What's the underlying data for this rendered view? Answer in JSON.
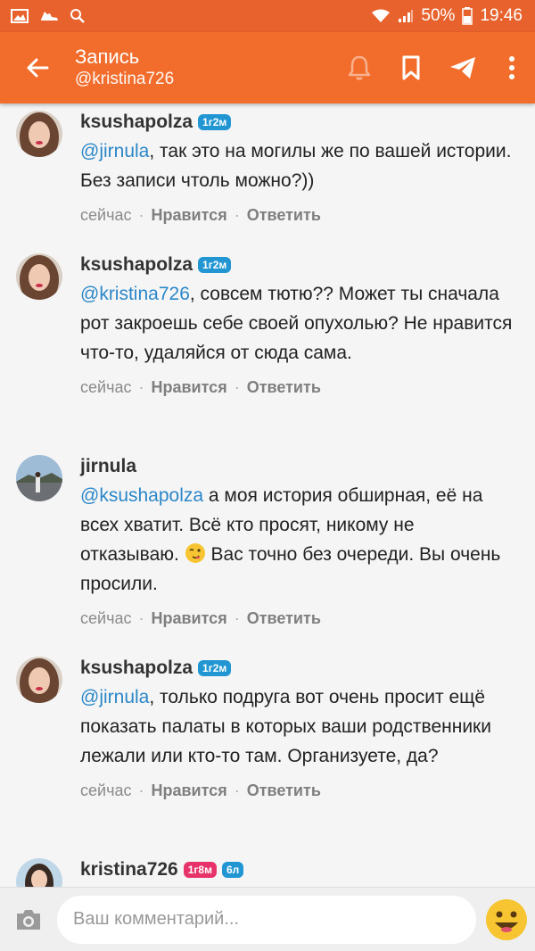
{
  "status_bar": {
    "battery": "50%",
    "time": "19:46"
  },
  "header": {
    "title": "Запись",
    "subtitle": "@kristina726"
  },
  "comments": [
    {
      "author": "ksushapolza",
      "badges": [
        "1г2м"
      ],
      "mention": "@jirnula",
      "text": ", так это на могилы же по вашей истории. Без записи чтоль можно?))",
      "time": "сейчас",
      "like": "Нравится",
      "reply": "Ответить"
    },
    {
      "author": "ksushapolza",
      "badges": [
        "1г2м"
      ],
      "mention": "@kristina726",
      "text": ", совсем тютю?? Может ты сначала рот закроешь себе своей опухолью? Не нравится что-то, удаляйся от сюда сама.",
      "time": "сейчас",
      "like": "Нравится",
      "reply": "Ответить"
    },
    {
      "author": "jirnula",
      "badges": [],
      "mention": "@ksushapolza",
      "text_before_emoji": " а моя история обширная, её на всех хватит. Всё кто просят, никому не отказываю.",
      "text_after_emoji": " Вас точно без очереди. Вы очень просили.",
      "time": "сейчас",
      "like": "Нравится",
      "reply": "Ответить"
    },
    {
      "author": "ksushapolza",
      "badges": [
        "1г2м"
      ],
      "mention": "@jirnula",
      "text": ", только подруга вот очень просит ещё показать палаты в которых ваши родственники лежали или кто-то там. Организуете, да?",
      "time": "сейчас",
      "like": "Нравится",
      "reply": "Ответить"
    },
    {
      "author": "kristina726",
      "badges": [
        "1г8м",
        "6л"
      ]
    }
  ],
  "comment_input": {
    "placeholder": "Ваш комментарий..."
  },
  "icons": {
    "back": "arrow-left-icon",
    "bell": "bell-icon",
    "bookmark": "bookmark-icon",
    "share": "send-icon",
    "menu": "more-vert-icon",
    "camera": "camera-icon",
    "emoji": "emoji-icon"
  },
  "colors": {
    "accent": "#f26d2c",
    "mention": "#2b87c8",
    "badge_blue": "#2196d3",
    "badge_pink": "#e8336a"
  }
}
